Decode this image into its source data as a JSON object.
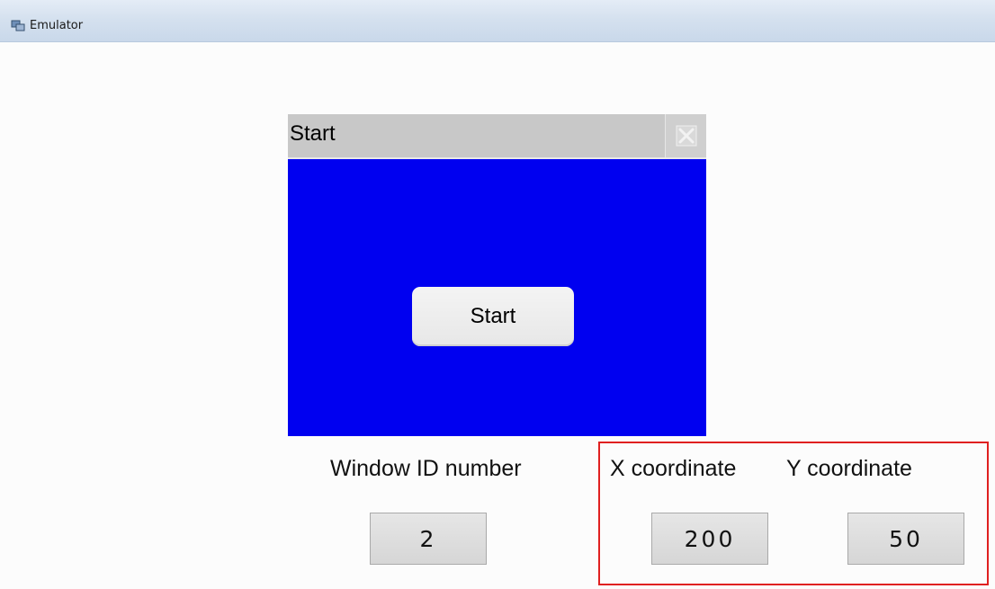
{
  "app": {
    "title": "Emulator",
    "icon": "emulator-app-icon"
  },
  "screen": {
    "window": {
      "title": "Start",
      "close_icon": "close-icon",
      "background_color": "#0000f0",
      "button_label": "Start"
    },
    "fields": {
      "window_id": {
        "label": "Window ID number",
        "value": "2"
      },
      "x_coord": {
        "label": "X coordinate",
        "value": "200"
      },
      "y_coord": {
        "label": "Y coordinate",
        "value": "50"
      }
    },
    "highlight_color": "#e02020"
  }
}
